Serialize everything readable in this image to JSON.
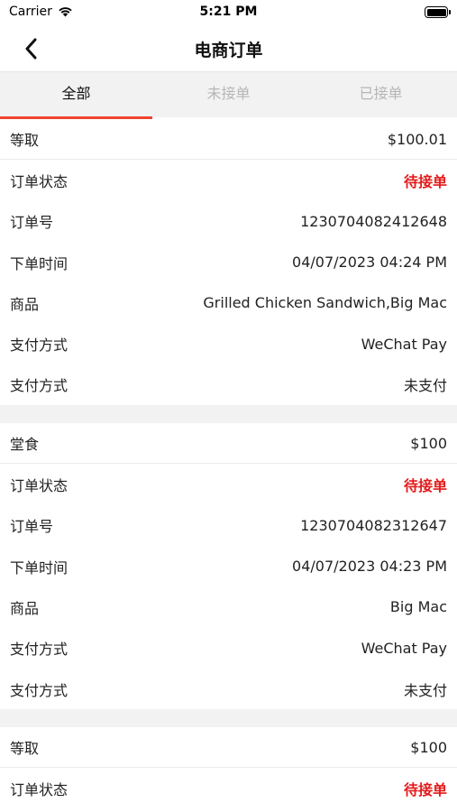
{
  "status_bar": {
    "carrier": "Carrier",
    "time": "5:21 PM"
  },
  "nav": {
    "title": "电商订单",
    "back_icon": "chevron-left-icon"
  },
  "tabs": [
    {
      "label": "全部",
      "active": true
    },
    {
      "label": "未接单",
      "active": false
    },
    {
      "label": "已接单",
      "active": false
    }
  ],
  "colors": {
    "accent": "#f0442e",
    "status": "#e31b1b",
    "tab_bg": "#f2f2f2"
  },
  "orders": [
    {
      "type": "等取",
      "amount": "$100.01",
      "status_label": "订单状态",
      "status": "待接单",
      "order_no_label": "订单号",
      "order_no": "1230704082412648",
      "time_label": "下单时间",
      "time": "04/07/2023 04:24 PM",
      "goods_label": "商品",
      "goods": "Grilled Chicken Sandwich,Big Mac",
      "pay_method_label": "支付方式",
      "pay_method": "WeChat Pay",
      "pay_status_label": "支付方式",
      "pay_status": "未支付"
    },
    {
      "type": "堂食",
      "amount": "$100",
      "status_label": "订单状态",
      "status": "待接单",
      "order_no_label": "订单号",
      "order_no": "1230704082312647",
      "time_label": "下单时间",
      "time": "04/07/2023 04:23 PM",
      "goods_label": "商品",
      "goods": "Big Mac",
      "pay_method_label": "支付方式",
      "pay_method": "WeChat Pay",
      "pay_status_label": "支付方式",
      "pay_status": "未支付"
    },
    {
      "type": "等取",
      "amount": "$100",
      "status_label": "订单状态",
      "status": "待接单"
    }
  ]
}
